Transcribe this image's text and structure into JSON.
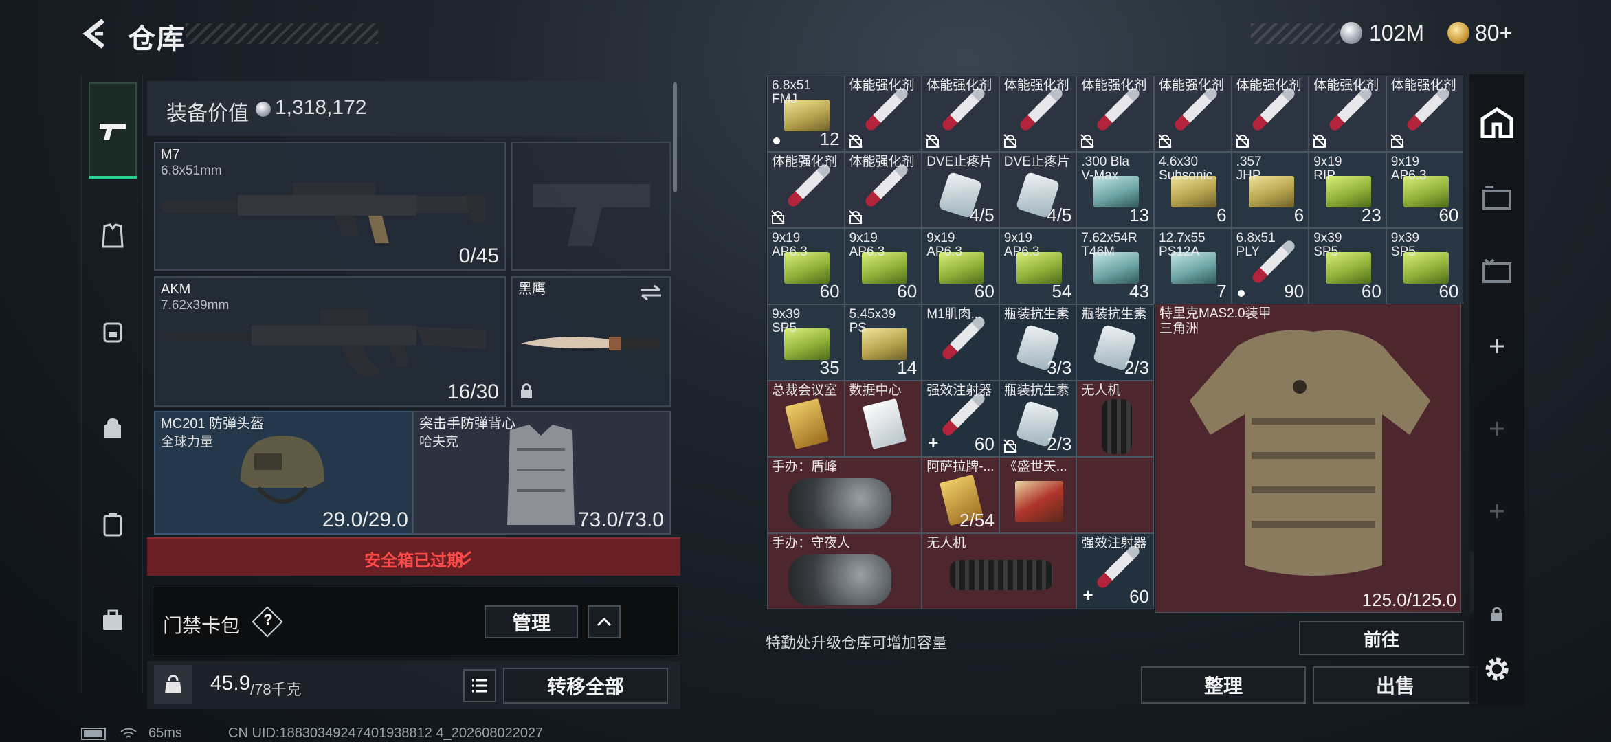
{
  "header": {
    "title": "仓库",
    "currency_silver": "102M",
    "currency_gold": "80+"
  },
  "nav": {
    "items": [
      "weapon-tab",
      "armor-tab",
      "backpack-tab",
      "bag-tab",
      "case-tab",
      "toolbox-tab"
    ]
  },
  "equipment": {
    "value_label": "装备价值",
    "value": "1,318,172",
    "primary": {
      "name": "M7",
      "caliber": "6.8x51mm",
      "ammo": "0/45"
    },
    "secondary": {
      "name": "AKM",
      "caliber": "7.62x39mm",
      "ammo": "16/30"
    },
    "melee": {
      "name": "黑鹰"
    },
    "helmet": {
      "name": "MC201 防弹头盔",
      "sub": "全球力量",
      "durability": "29.0/29.0"
    },
    "armor": {
      "name": "突击手防弹背心",
      "sub": "哈夫克",
      "durability": "73.0/73.0"
    },
    "safebox_status": "安全箱已过期",
    "keycard": {
      "label": "门禁卡包",
      "help": "?",
      "manage": "管理"
    },
    "weight": {
      "current": "45.9",
      "max": "/78千克"
    },
    "transfer_all": "转移全部"
  },
  "stash": {
    "rows": [
      [
        {
          "n": "6.8x51\nFMJ",
          "c": "12",
          "t": "m",
          "icon": "box-yellow",
          "mk": "dot"
        },
        {
          "n": "体能强化剂",
          "c": "",
          "t": "m",
          "icon": "syringe",
          "mk": "lock"
        },
        {
          "n": "体能强化剂",
          "c": "",
          "t": "m",
          "icon": "syringe",
          "mk": "lock"
        },
        {
          "n": "体能强化剂",
          "c": "",
          "t": "m",
          "icon": "syringe",
          "mk": "lock"
        },
        {
          "n": "体能强化剂",
          "c": "",
          "t": "m",
          "icon": "syringe",
          "mk": "lock"
        },
        {
          "n": "体能强化剂",
          "c": "",
          "t": "m",
          "icon": "syringe",
          "mk": "lock"
        },
        {
          "n": "体能强化剂",
          "c": "",
          "t": "m",
          "icon": "syringe",
          "mk": "lock"
        },
        {
          "n": "体能强化剂",
          "c": "",
          "t": "m",
          "icon": "syringe",
          "mk": "lock"
        },
        {
          "n": "体能强化剂",
          "c": "",
          "t": "m",
          "icon": "syringe",
          "mk": "lock"
        }
      ],
      [
        {
          "n": "体能强化剂",
          "c": "",
          "t": "m",
          "icon": "syringe",
          "mk": "lock"
        },
        {
          "n": "体能强化剂",
          "c": "",
          "t": "m",
          "icon": "syringe",
          "mk": "lock"
        },
        {
          "n": "DVE止疼片",
          "c": "4/5",
          "t": "m",
          "icon": "pills",
          "mk": ""
        },
        {
          "n": "DVE止疼片",
          "c": "4/5",
          "t": "m",
          "icon": "pills",
          "mk": ""
        },
        {
          "n": ".300 Bla\nV-Max",
          "c": "13",
          "t": "g",
          "icon": "box-teal",
          "mk": ""
        },
        {
          "n": "4.6x30\nSubsonic",
          "c": "6",
          "t": "g",
          "icon": "box-yellow",
          "mk": ""
        },
        {
          "n": ".357\nJHP",
          "c": "6",
          "t": "g",
          "icon": "box-yellow",
          "mk": ""
        },
        {
          "n": "9x19\nRIP",
          "c": "23",
          "t": "g",
          "icon": "box-green",
          "mk": ""
        },
        {
          "n": "9x19\nAP6.3",
          "c": "60",
          "t": "g",
          "icon": "box-green",
          "mk": ""
        }
      ],
      [
        {
          "n": "9x19\nAP6.3",
          "c": "60",
          "t": "g",
          "icon": "box-green",
          "mk": ""
        },
        {
          "n": "9x19\nAP6.3",
          "c": "60",
          "t": "g",
          "icon": "box-green",
          "mk": ""
        },
        {
          "n": "9x19\nAP6.3",
          "c": "60",
          "t": "g",
          "icon": "box-green",
          "mk": ""
        },
        {
          "n": "9x19\nAP6.3",
          "c": "54",
          "t": "g",
          "icon": "box-green",
          "mk": ""
        },
        {
          "n": "7.62x54R\nT46M",
          "c": "43",
          "t": "g",
          "icon": "box-teal",
          "mk": ""
        },
        {
          "n": "12.7x55\nPS12A",
          "c": "7",
          "t": "g",
          "icon": "box-teal",
          "mk": ""
        },
        {
          "n": "6.8x51\nPLY",
          "c": "90",
          "t": "g",
          "icon": "syringe",
          "mk": "dot"
        },
        {
          "n": "9x39\nSP5",
          "c": "60",
          "t": "g",
          "icon": "box-green",
          "mk": ""
        },
        {
          "n": "9x39\nSP5",
          "c": "60",
          "t": "g",
          "icon": "box-green",
          "mk": ""
        }
      ],
      [
        {
          "n": "9x39\nSP5",
          "c": "35",
          "t": "g",
          "icon": "box-green",
          "mk": ""
        },
        {
          "n": "5.45x39\nPS",
          "c": "14",
          "t": "g",
          "icon": "box-yellow",
          "mk": ""
        },
        {
          "n": "M1肌肉...",
          "c": "",
          "t": "dk",
          "icon": "syringe",
          "mk": ""
        },
        {
          "n": "瓶装抗生素",
          "c": "3/3",
          "t": "dk",
          "icon": "pills",
          "mk": ""
        },
        {
          "n": "瓶装抗生素",
          "c": "2/3",
          "t": "dk",
          "icon": "pills",
          "mk": ""
        }
      ],
      [
        {
          "n": "总裁会议室",
          "c": "",
          "t": "r",
          "icon": "card",
          "mk": ""
        },
        {
          "n": "数据中心",
          "c": "",
          "t": "r",
          "icon": "card-white",
          "mk": ""
        },
        {
          "n": "强效注射器",
          "c": "60",
          "t": "dk",
          "icon": "syringe",
          "mk": "plus"
        },
        {
          "n": "瓶装抗生素",
          "c": "2/3",
          "t": "dk",
          "icon": "pills",
          "mk": "lock"
        },
        {
          "n": "无人机",
          "c": "",
          "t": "r",
          "icon": "drone",
          "mk": ""
        }
      ],
      [
        {
          "n": "手办：盾峰",
          "c": "",
          "t": "r",
          "icon": "figure",
          "mk": ""
        },
        {
          "n": "",
          "c": "",
          "t": "r",
          "icon": "",
          "mk": ""
        },
        {
          "n": "阿萨拉牌-...",
          "c": "2/54",
          "t": "r",
          "icon": "card",
          "mk": ""
        },
        {
          "n": "《盛世天...",
          "c": "",
          "t": "r",
          "icon": "painting",
          "mk": ""
        },
        {
          "n": "",
          "c": "",
          "t": "r",
          "icon": "",
          "mk": ""
        }
      ],
      [
        {
          "n": "手办：守夜人",
          "c": "",
          "t": "r",
          "icon": "figure",
          "mk": ""
        },
        {
          "n": "",
          "c": "",
          "t": "r",
          "icon": "",
          "mk": ""
        },
        {
          "n": "无人机",
          "c": "",
          "t": "r",
          "icon": "drone",
          "mk": ""
        },
        {
          "n": "",
          "c": "",
          "t": "r",
          "icon": "",
          "mk": ""
        },
        {
          "n": "强效注射器",
          "c": "60",
          "t": "dk",
          "icon": "syringe",
          "mk": "plus"
        }
      ]
    ],
    "big_vest": {
      "name": "特里克MAS2.0装甲",
      "sub": "三角洲",
      "durability": "125.0/125.0"
    },
    "upgrade_hint": "特勤处升级仓库可增加容量",
    "goto": "前往",
    "sort": "整理",
    "sell": "出售"
  },
  "status": {
    "ping": "65ms",
    "uid": "CN UID:18830349247401938812 4_202608022027"
  },
  "colors": {
    "accent_green": "#29d08f",
    "danger_red": "#ff4a4a",
    "rare_red_bg": "#4e262d"
  }
}
